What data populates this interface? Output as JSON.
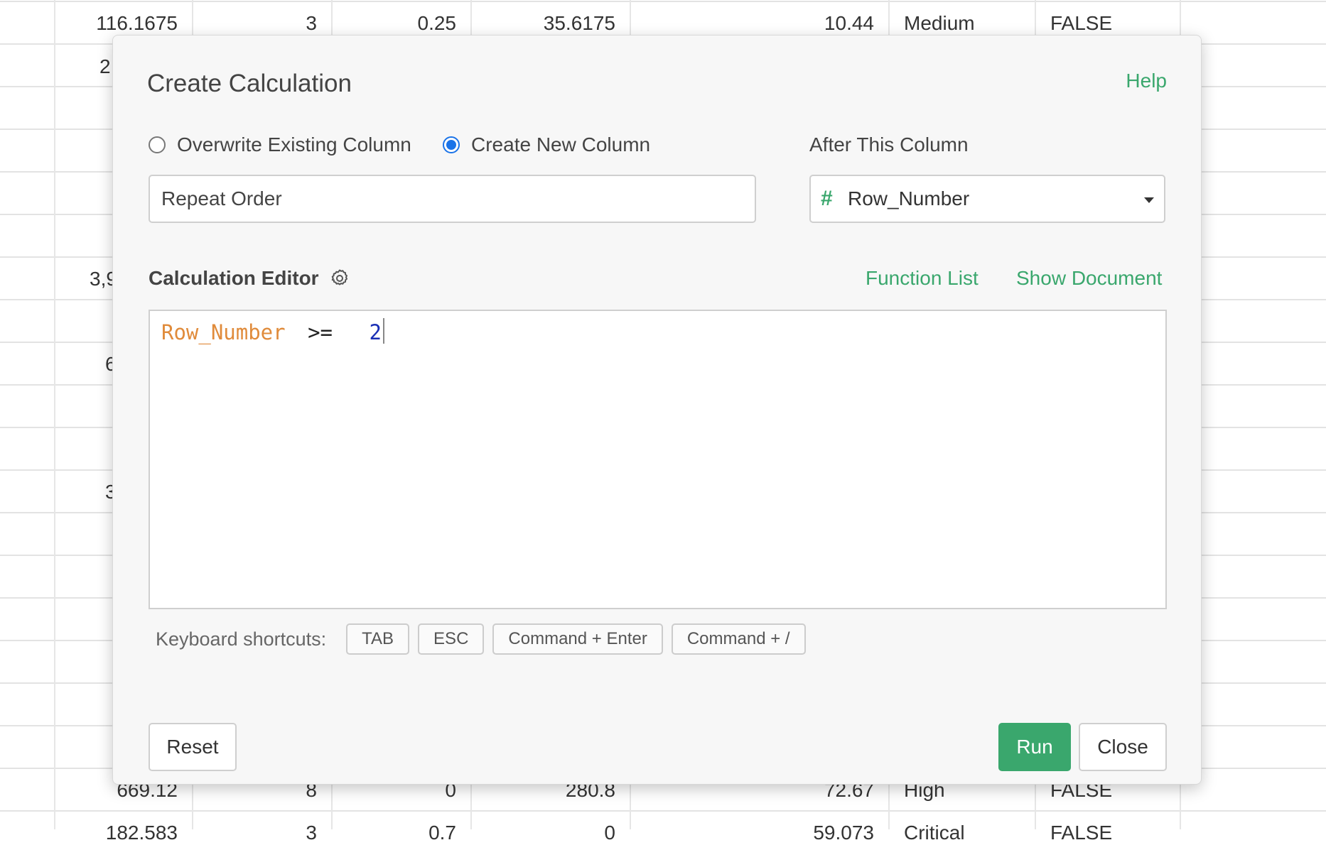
{
  "background_table": {
    "row_top": [
      "116.1675",
      "3",
      "0.25",
      "35.6175",
      "10.44",
      "Medium",
      "FALSE"
    ],
    "row_bottom": [
      "669.12",
      "8",
      "0",
      "280.8",
      "72.67",
      "High",
      "FALSE"
    ],
    "row_cut": [
      "182.583",
      "3",
      "0.7",
      "0",
      "59.073",
      "Critical",
      "FALSE"
    ],
    "partial_left": [
      "2",
      "3,9",
      "6",
      "3"
    ]
  },
  "dialog": {
    "title": "Create Calculation",
    "help_link": "Help",
    "radio_overwrite": "Overwrite Existing Column",
    "radio_create": "Create New Column",
    "selected_mode": "create",
    "after_column_label": "After This Column",
    "new_column_name": "Repeat Order",
    "after_column_value": "Row_Number",
    "after_column_type_icon": "#",
    "editor_label": "Calculation Editor",
    "function_list_link": "Function List",
    "show_document_link": "Show Document",
    "expression": {
      "field": "Row_Number",
      "operator": ">=",
      "number": "2"
    },
    "shortcuts_label": "Keyboard shortcuts:",
    "shortcuts": [
      "TAB",
      "ESC",
      "Command + Enter",
      "Command + /"
    ],
    "reset_button": "Reset",
    "run_button": "Run",
    "close_button": "Close"
  },
  "colors": {
    "accent_green": "#3aa76d",
    "radio_blue": "#1a73e8",
    "field_orange": "#e08b3b",
    "number_blue": "#1a2fb5"
  }
}
